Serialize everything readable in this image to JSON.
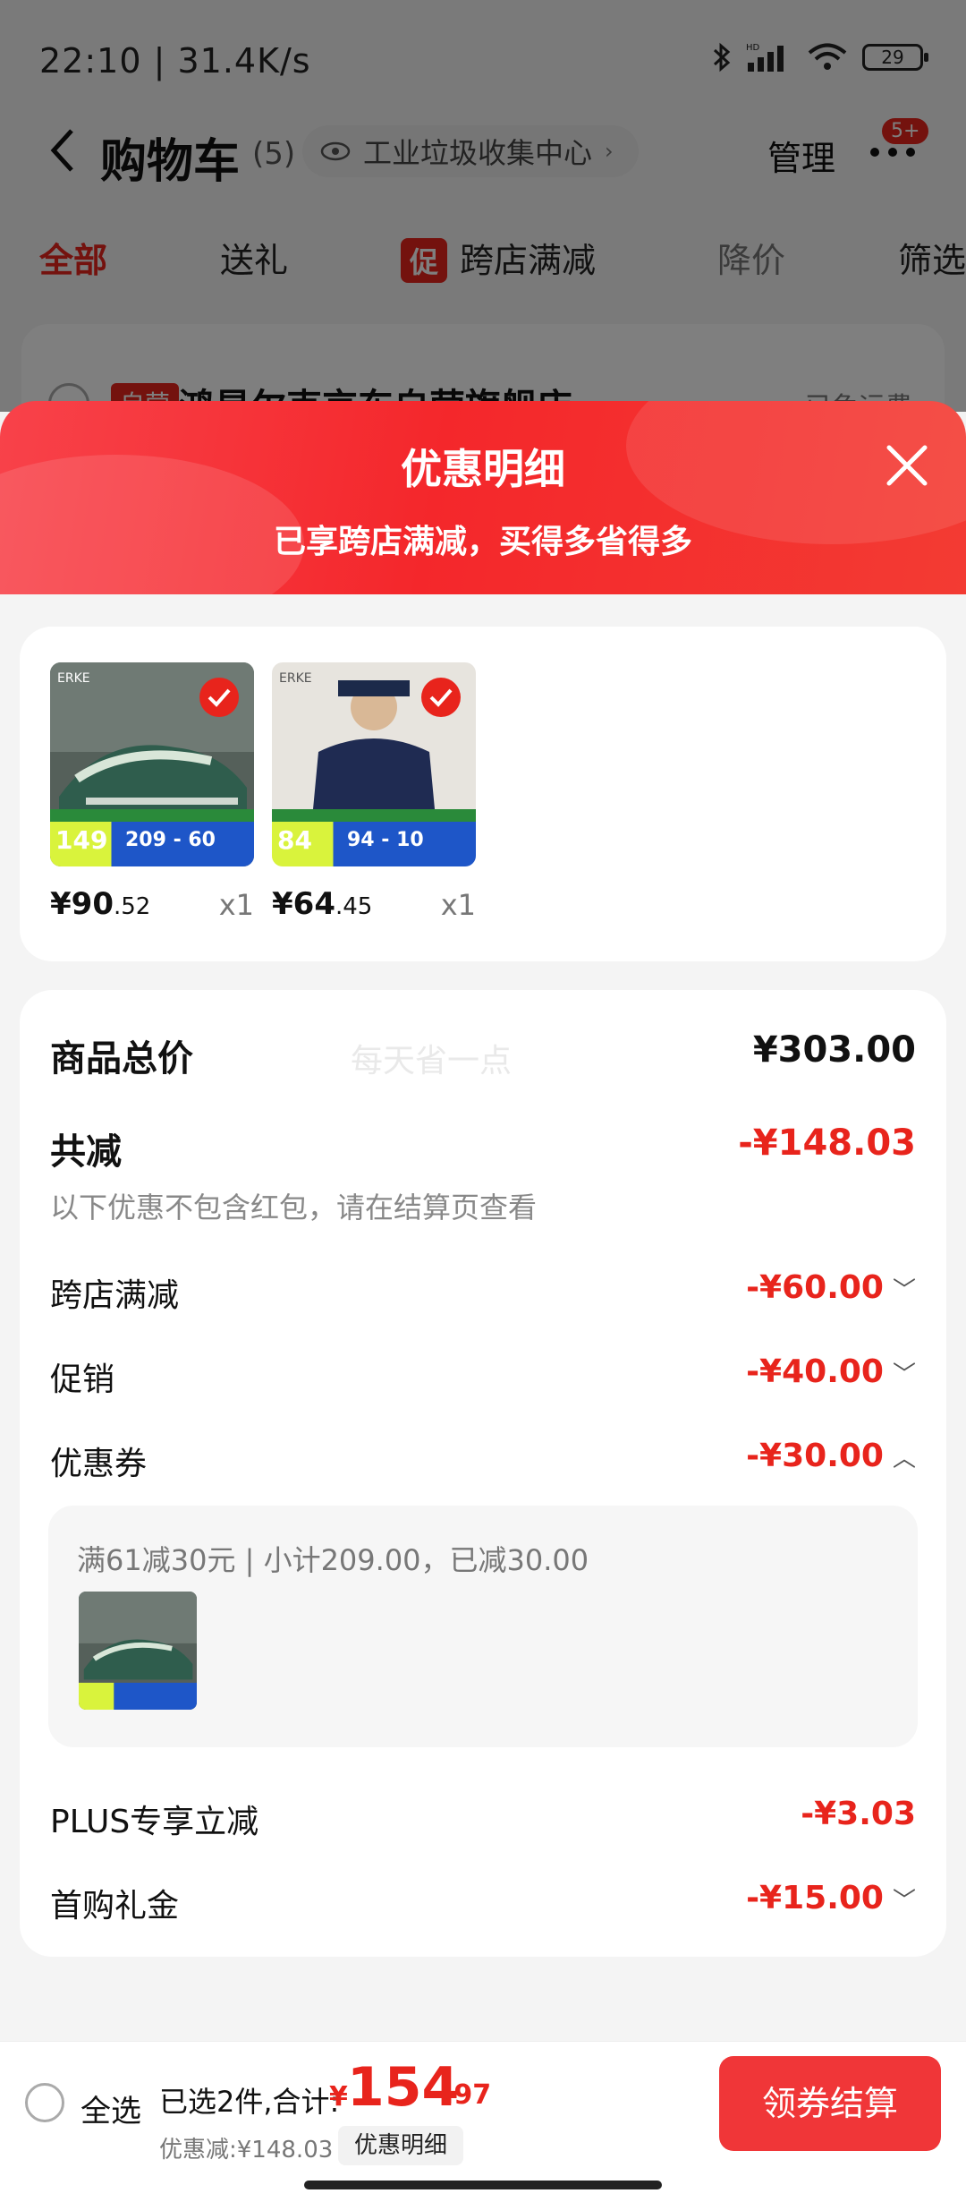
{
  "status": {
    "time": "22:10 | 31.4K/s",
    "battery": "29",
    "net_label": "HD"
  },
  "cart": {
    "title": "购物车",
    "count": "(5)",
    "address": "工业垃圾收集中心",
    "manage": "管理",
    "badge": "5+"
  },
  "tabs": {
    "all": "全部",
    "gift": "送礼",
    "promo_badge": "促",
    "cross_store": "跨店满减",
    "price_drop": "降价",
    "filter": "筛选"
  },
  "shop": {
    "tag": "自营",
    "name": "鸿星尔克京东自营旗舰店",
    "right": "已免运费"
  },
  "sheet": {
    "title": "优惠明细",
    "subtitle": "已享跨店满减，买得多省得多"
  },
  "products": [
    {
      "strip_price": "149",
      "strip_promo": "209 - 60",
      "price_int": "¥90",
      "price_dec": ".52",
      "qty": "x1",
      "image": "sneaker"
    },
    {
      "strip_price": "84",
      "strip_promo": "94 - 10",
      "price_int": "¥64",
      "price_dec": ".45",
      "qty": "x1",
      "image": "sweatshirt"
    }
  ],
  "summary": {
    "total_label": "商品总价",
    "total_value": "¥303.00",
    "watermark": "每天省一点",
    "reduce_label": "共减",
    "reduce_value": "-¥148.03",
    "note": "以下优惠不包含红包，请在结算页查看",
    "items": [
      {
        "label": "跨店满减",
        "value": "-¥60.00",
        "chevron": "﹀"
      },
      {
        "label": "促销",
        "value": "-¥40.00",
        "chevron": "﹀"
      },
      {
        "label": "优惠券",
        "value": "-¥30.00",
        "chevron": "︿"
      }
    ],
    "coupon_detail": "满61减30元 | 小计209.00，已减30.00",
    "plus_label": "PLUS专享立减",
    "plus_value": "-¥3.03",
    "first_label": "首购礼金",
    "first_value": "-¥15.00",
    "first_chevron": "﹀"
  },
  "bottom": {
    "select_all": "全选",
    "selected": "已选2件,合计:",
    "yen": "¥",
    "total_int": "154",
    "total_dec": ".97",
    "discount": "优惠减:¥148.03",
    "detail_btn": "优惠明细",
    "checkout": "领券结算"
  },
  "colors": {
    "accent": "#e8241c",
    "checkout": "#f03638"
  }
}
